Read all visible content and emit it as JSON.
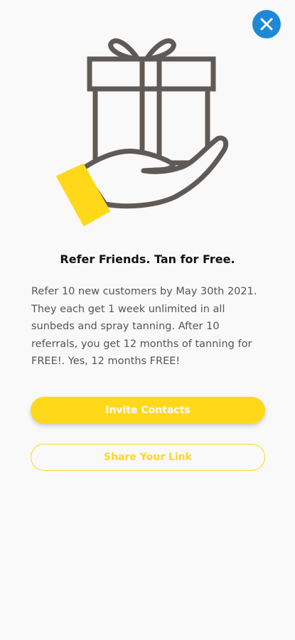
{
  "header": {
    "close_icon": "close-icon"
  },
  "illustration": {
    "icon": "gift-in-hand-icon"
  },
  "content": {
    "title": "Refer Friends. Tan for Free.",
    "description": "Refer 10 new customers by May 30th 2021. They each get 1 week unlimited in all sunbeds and spray tanning. After 10 referrals, you get 12 months of tanning for FREE!. Yes, 12 months FREE!"
  },
  "actions": {
    "invite_label": "Invite Contacts",
    "share_label": "Share Your Link"
  },
  "colors": {
    "accent": "#ffd81a",
    "close_button": "#1e88d6",
    "outline": "#5f5a55",
    "background": "#f9f9f9"
  }
}
